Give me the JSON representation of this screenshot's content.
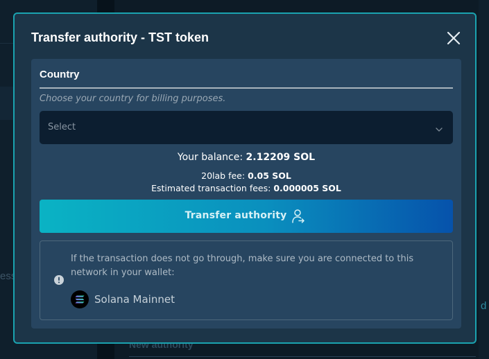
{
  "modal": {
    "title": "Transfer authority - TST token",
    "close_icon": "close-icon"
  },
  "country_field": {
    "label": "Country",
    "hint": "Choose your country for billing purposes.",
    "select_value": "Select"
  },
  "balance": {
    "label": "Your balance:",
    "value": "2.12209 SOL"
  },
  "fees": {
    "lab_fee_label": "20lab fee:",
    "lab_fee_value": "0.05 SOL",
    "tx_fee_label": "Estimated transaction fees:",
    "tx_fee_value": "0.000005 SOL"
  },
  "primary_button": {
    "label": "Transfer authority",
    "icon": "user-transfer-icon"
  },
  "notice": {
    "icon": "alert-circle-icon",
    "text": "If the transaction does not go through, make sure you are connected to this network in your wallet:",
    "network_name": "Solana Mainnet",
    "network_icon": "solana-logo-icon"
  },
  "colors": {
    "modal_border": "#1aa3b0",
    "modal_bg": "#1c3548",
    "panel_bg": "#274560",
    "select_bg": "#0c1e30",
    "button_gradient_start": "#0ab3c4",
    "button_gradient_end": "#0652ab"
  },
  "background": {
    "left_text": "ess",
    "right_text": "d",
    "bottom_text": "New authority"
  }
}
